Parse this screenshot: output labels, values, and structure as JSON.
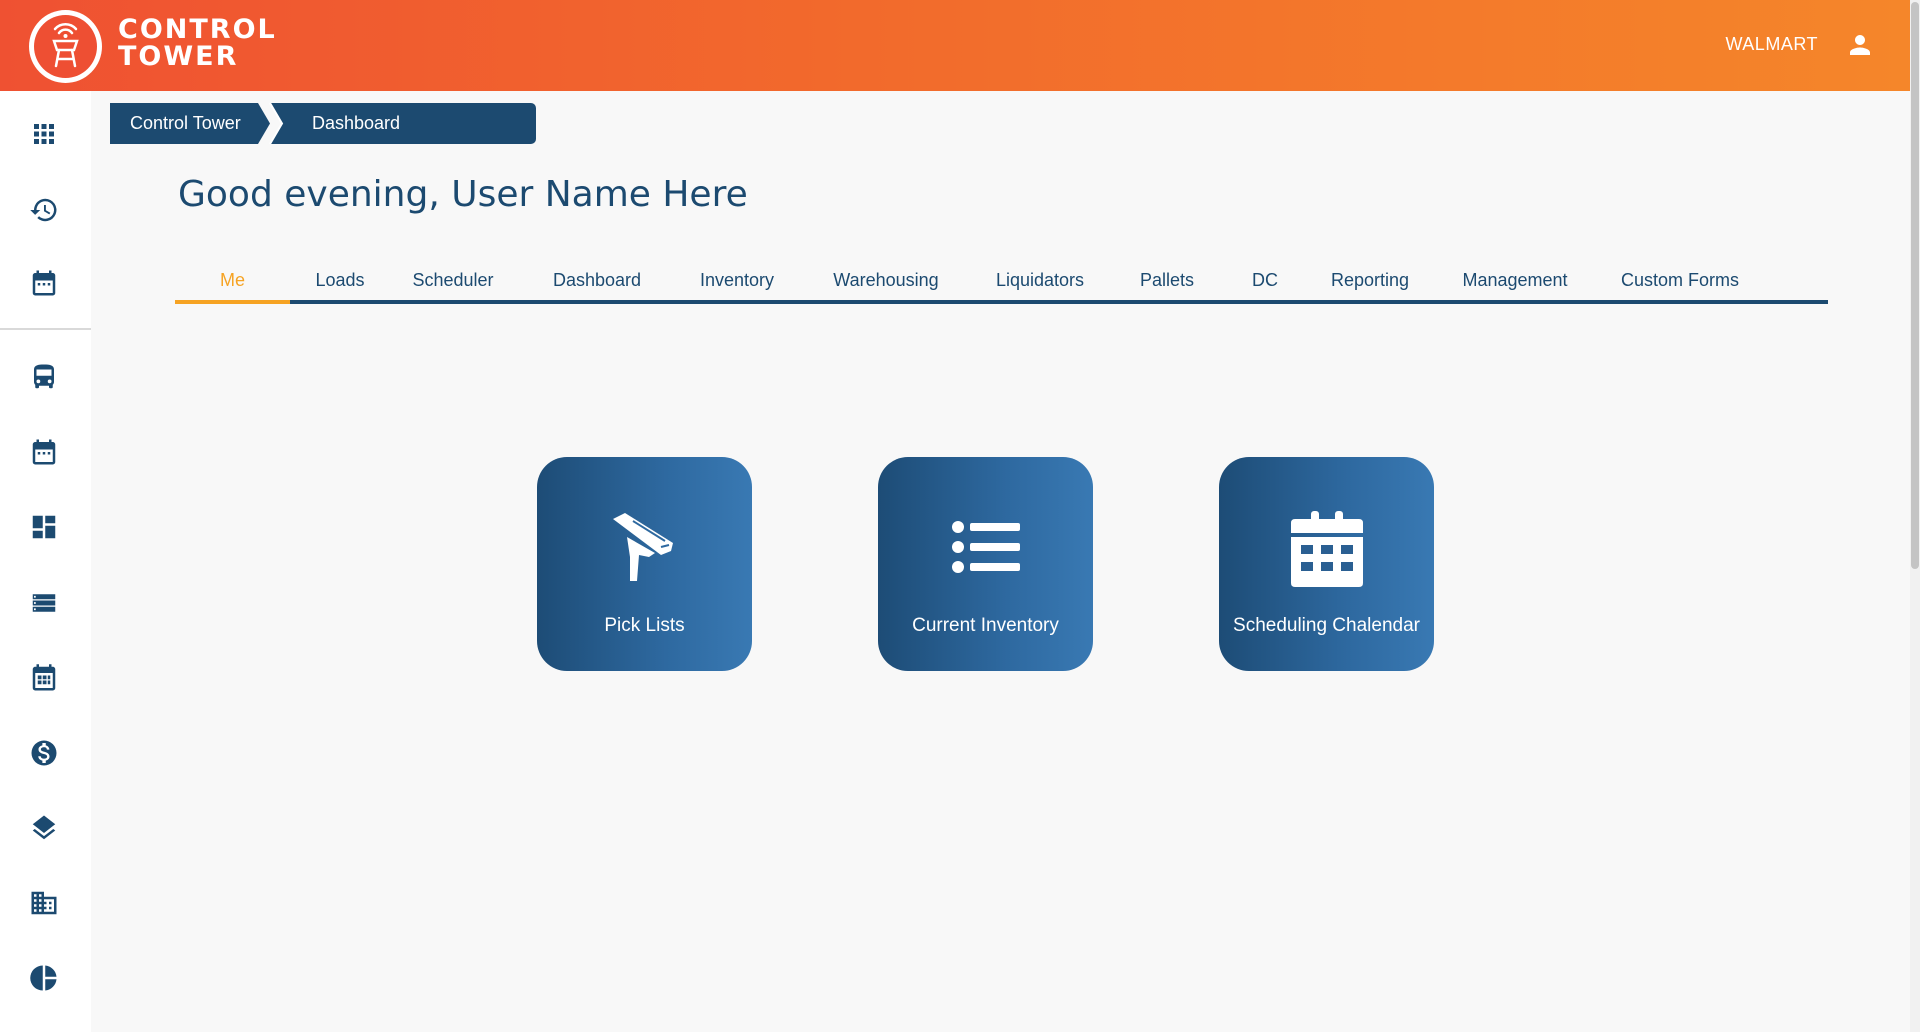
{
  "header": {
    "logo_line1": "CONTROL",
    "logo_line2": "TOWER",
    "client_name": "WALMART"
  },
  "sidebar": {
    "items": [
      {
        "name": "apps-grid-icon"
      },
      {
        "name": "history-icon"
      },
      {
        "name": "calendar-icon"
      },
      {
        "name": "bus-icon"
      },
      {
        "name": "calendar-alt-icon"
      },
      {
        "name": "dashboard-icon"
      },
      {
        "name": "list-icon"
      },
      {
        "name": "calendar-grid-icon"
      },
      {
        "name": "dollar-icon"
      },
      {
        "name": "layers-icon"
      },
      {
        "name": "building-icon"
      },
      {
        "name": "pie-chart-icon"
      }
    ]
  },
  "breadcrumb": [
    "Control Tower",
    "Dashboard"
  ],
  "greeting": "Good evening, User Name Here",
  "tabs": [
    {
      "label": "Me",
      "active": true
    },
    {
      "label": "Loads"
    },
    {
      "label": "Scheduler"
    },
    {
      "label": "Dashboard"
    },
    {
      "label": "Inventory"
    },
    {
      "label": "Warehousing"
    },
    {
      "label": "Liquidators"
    },
    {
      "label": "Pallets"
    },
    {
      "label": "DC"
    },
    {
      "label": "Reporting"
    },
    {
      "label": "Management"
    },
    {
      "label": "Custom Forms"
    }
  ],
  "tiles": [
    {
      "label": "Pick Lists",
      "icon": "scanner-icon"
    },
    {
      "label": "Current Inventory",
      "icon": "list-icon"
    },
    {
      "label": "Scheduling Chalendar",
      "icon": "calendar-icon"
    }
  ],
  "colors": {
    "brand_orange_start": "#ef5132",
    "brand_orange_end": "#f5862a",
    "navy": "#1c4a70",
    "active_tab": "#f6a323"
  }
}
